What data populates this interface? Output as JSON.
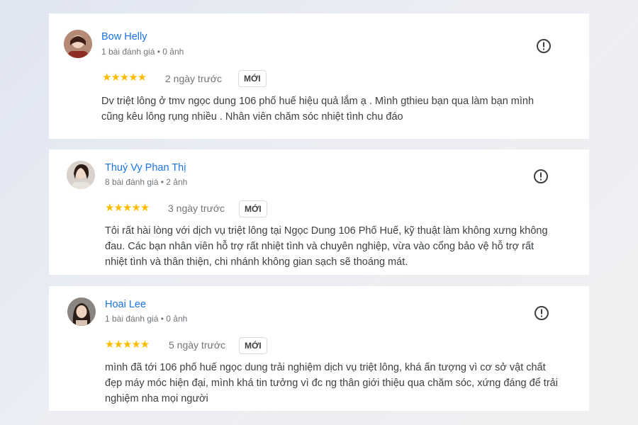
{
  "reviews": [
    {
      "name": "Bow Helly",
      "meta": "1 bài đánh giá • 0 ảnh",
      "rating": 5,
      "stars": "★★★★★",
      "date": "2 ngày trước",
      "badge": "MỚI",
      "text": "Dv triệt lông ở tmv ngọc dung 106 phố huế hiệu quả lắm ạ . Mình gthieu bạn qua làm bạn mình cũng kêu lông rụng nhiều . Nhân viên chăm sóc nhiệt tình chu đáo",
      "icon": "report-flag-icon"
    },
    {
      "name": "Thuý Vy Phan Thị",
      "meta": "8 bài đánh giá • 2 ảnh",
      "rating": 5,
      "stars": "★★★★★",
      "date": "3 ngày trước",
      "badge": "MỚI",
      "text": "Tôi rất hài lòng với dịch vụ triệt lông tại Ngọc Dung 106 Phố Huế, kỹ thuật làm không xưng không đau. Các bạn nhân viên hỗ trợ rất nhiệt tình và chuyên nghiệp, vừa vào cổng bảo vệ hỗ trợ rất nhiệt tình và thân thiện, chi nhánh không gian sạch sẽ thoáng mát.",
      "icon": "report-flag-icon"
    },
    {
      "name": "Hoai Lee",
      "meta": "1 bài đánh giá • 0 ảnh",
      "rating": 5,
      "stars": "★★★★★",
      "date": "5 ngày trước",
      "badge": "MỚI",
      "text": "mình đã tới 106 phố huế ngọc dung trải nghiệm dịch vụ triệt lông, khá ấn tượng vì cơ sở vật chất đẹp máy móc hiện đại, mình khá tin tưởng vì đc ng thân giới thiệu qua chăm sóc, xứng đáng để trải nghiệm nha mọi người",
      "icon": "report-flag-icon"
    }
  ],
  "colors": {
    "name": "#1a73e8",
    "star": "#fbbc04",
    "secondary": "#70757a",
    "text": "#3c4043"
  }
}
